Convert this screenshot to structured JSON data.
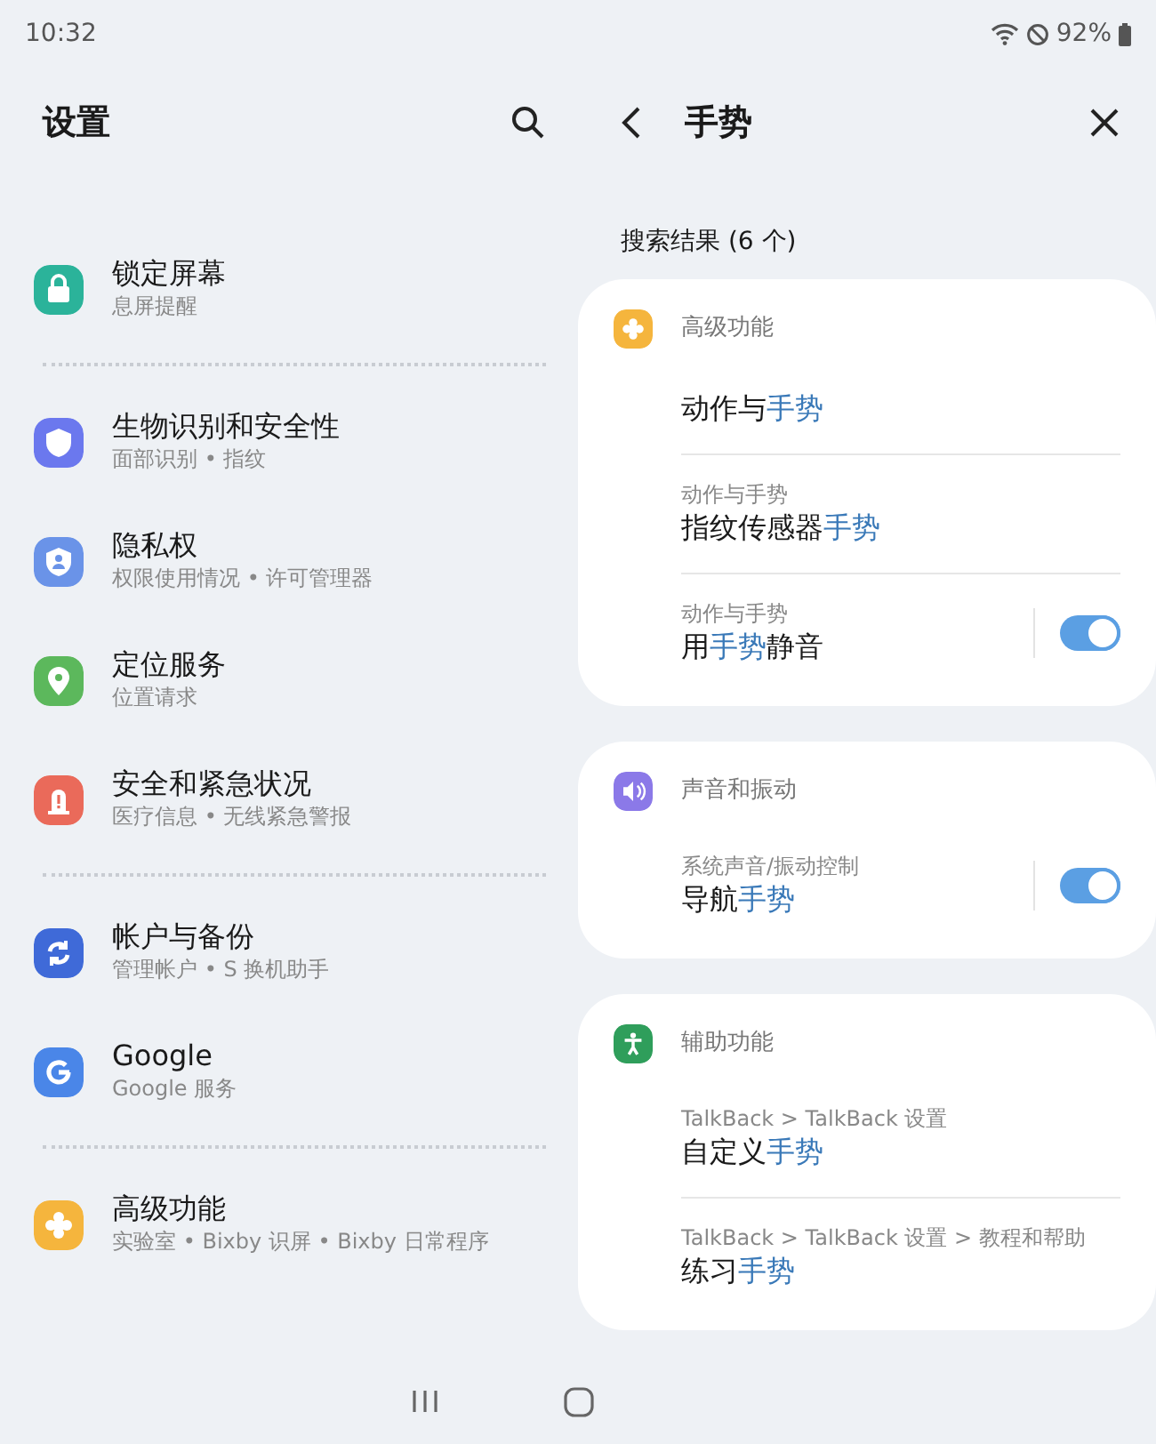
{
  "status_bar": {
    "time": "10:32",
    "battery": "92%"
  },
  "settings": {
    "title": "设置",
    "sections": [
      [
        {
          "title": "锁定屏幕",
          "subtitle": "息屏提醒",
          "kind": "lock",
          "color": "#2bb39a"
        }
      ],
      [
        {
          "title": "生物识别和安全性",
          "subtitle": "面部识别 • 指纹",
          "kind": "shield",
          "color": "#6b78ee"
        },
        {
          "title": "隐私权",
          "subtitle": "权限使用情况 • 许可管理器",
          "kind": "privacy",
          "color": "#6a93e8"
        },
        {
          "title": "定位服务",
          "subtitle": "位置请求",
          "kind": "location",
          "color": "#5cb85c"
        },
        {
          "title": "安全和紧急状况",
          "subtitle": "医疗信息 • 无线紧急警报",
          "kind": "alert",
          "color": "#ea6a5a"
        }
      ],
      [
        {
          "title": "帐户与备份",
          "subtitle": "管理帐户 • S 换机助手",
          "kind": "sync",
          "color": "#3f6ad8"
        },
        {
          "title": "Google",
          "subtitle": "Google 服务",
          "kind": "google",
          "color": "#4a86e8"
        }
      ],
      [
        {
          "title": "高级功能",
          "subtitle": "实验室 • Bixby 识屏 • Bixby 日常程序",
          "kind": "gear",
          "color": "#f5b53d"
        }
      ]
    ]
  },
  "search": {
    "title": "手势",
    "results_label": "搜索结果 (6 个)",
    "groups": [
      {
        "name": "高级功能",
        "kind": "gear",
        "color": "#f5b53d",
        "results": [
          {
            "title": [
              {
                "text": "动作与",
                "match": false
              },
              {
                "text": "手势",
                "match": true
              }
            ]
          },
          {
            "path": "动作与手势",
            "title": [
              {
                "text": "指纹传感器",
                "match": false
              },
              {
                "text": "手势",
                "match": true
              }
            ]
          },
          {
            "path": "动作与手势",
            "title": [
              {
                "text": "用",
                "match": false
              },
              {
                "text": "手势",
                "match": true
              },
              {
                "text": "静音",
                "match": false
              }
            ],
            "toggle": {
              "on": true
            }
          }
        ]
      },
      {
        "name": "声音和振动",
        "kind": "sound",
        "color": "#8b79e8",
        "results": [
          {
            "path": "系统声音/振动控制",
            "title": [
              {
                "text": "导航",
                "match": false
              },
              {
                "text": "手势",
                "match": true
              }
            ],
            "toggle": {
              "on": true
            }
          }
        ]
      },
      {
        "name": "辅助功能",
        "kind": "access",
        "color": "#2f9e5b",
        "results": [
          {
            "path": "TalkBack > TalkBack 设置",
            "title": [
              {
                "text": "自定义",
                "match": false
              },
              {
                "text": "手势",
                "match": true
              }
            ]
          },
          {
            "path": "TalkBack > TalkBack 设置 > 教程和帮助",
            "title": [
              {
                "text": "练习",
                "match": false
              },
              {
                "text": "手势",
                "match": true
              }
            ]
          }
        ]
      }
    ]
  }
}
